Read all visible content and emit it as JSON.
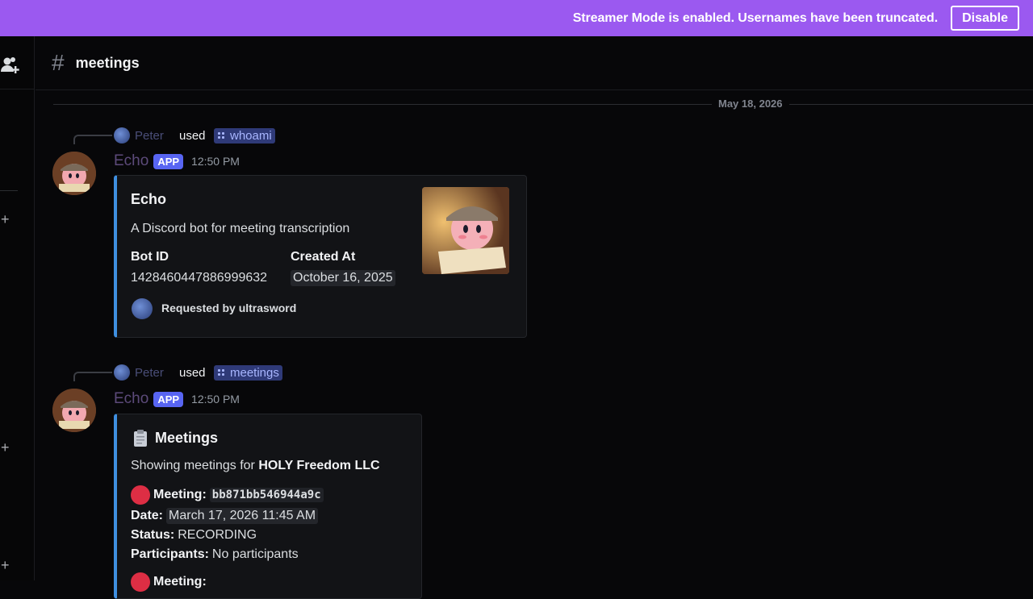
{
  "banner": {
    "text": "Streamer Mode is enabled. Usernames have been truncated.",
    "button": "Disable"
  },
  "channel": {
    "name": "meetings"
  },
  "date_divider": "May 18, 2026",
  "messages": [
    {
      "reply_user": "Peter",
      "reply_used": "used",
      "command": "whoami",
      "author": "Echo",
      "badge": "APP",
      "time": "12:50 PM",
      "embed": {
        "title": "Echo",
        "description": "A Discord bot for meeting transcription",
        "fields": [
          {
            "name": "Bot ID",
            "value": "1428460447886999632"
          },
          {
            "name": "Created At",
            "value": "October 16, 2025"
          }
        ],
        "footer": "Requested by ultrasword"
      }
    },
    {
      "reply_user": "Peter",
      "reply_used": "used",
      "command": "meetings",
      "author": "Echo",
      "badge": "APP",
      "time": "12:50 PM",
      "embed": {
        "title": "Meetings",
        "description_prefix": "Showing meetings for ",
        "description_bold": "HOLY Freedom LLC",
        "meeting_label": "Meeting:",
        "meeting_id": "bb871bb546944a9c",
        "date_label": "Date:",
        "date_value": "March 17, 2026 11:45 AM",
        "status_label": "Status:",
        "status_value": "RECORDING",
        "participants_label": "Participants:",
        "participants_value": "No participants",
        "next_meeting_label": "Meeting:"
      }
    }
  ],
  "colors": {
    "banner": "#9b59f0",
    "embed_accent": "#3f8fe0",
    "app_badge": "#5865f2",
    "command_bg": "#2f3a78"
  }
}
